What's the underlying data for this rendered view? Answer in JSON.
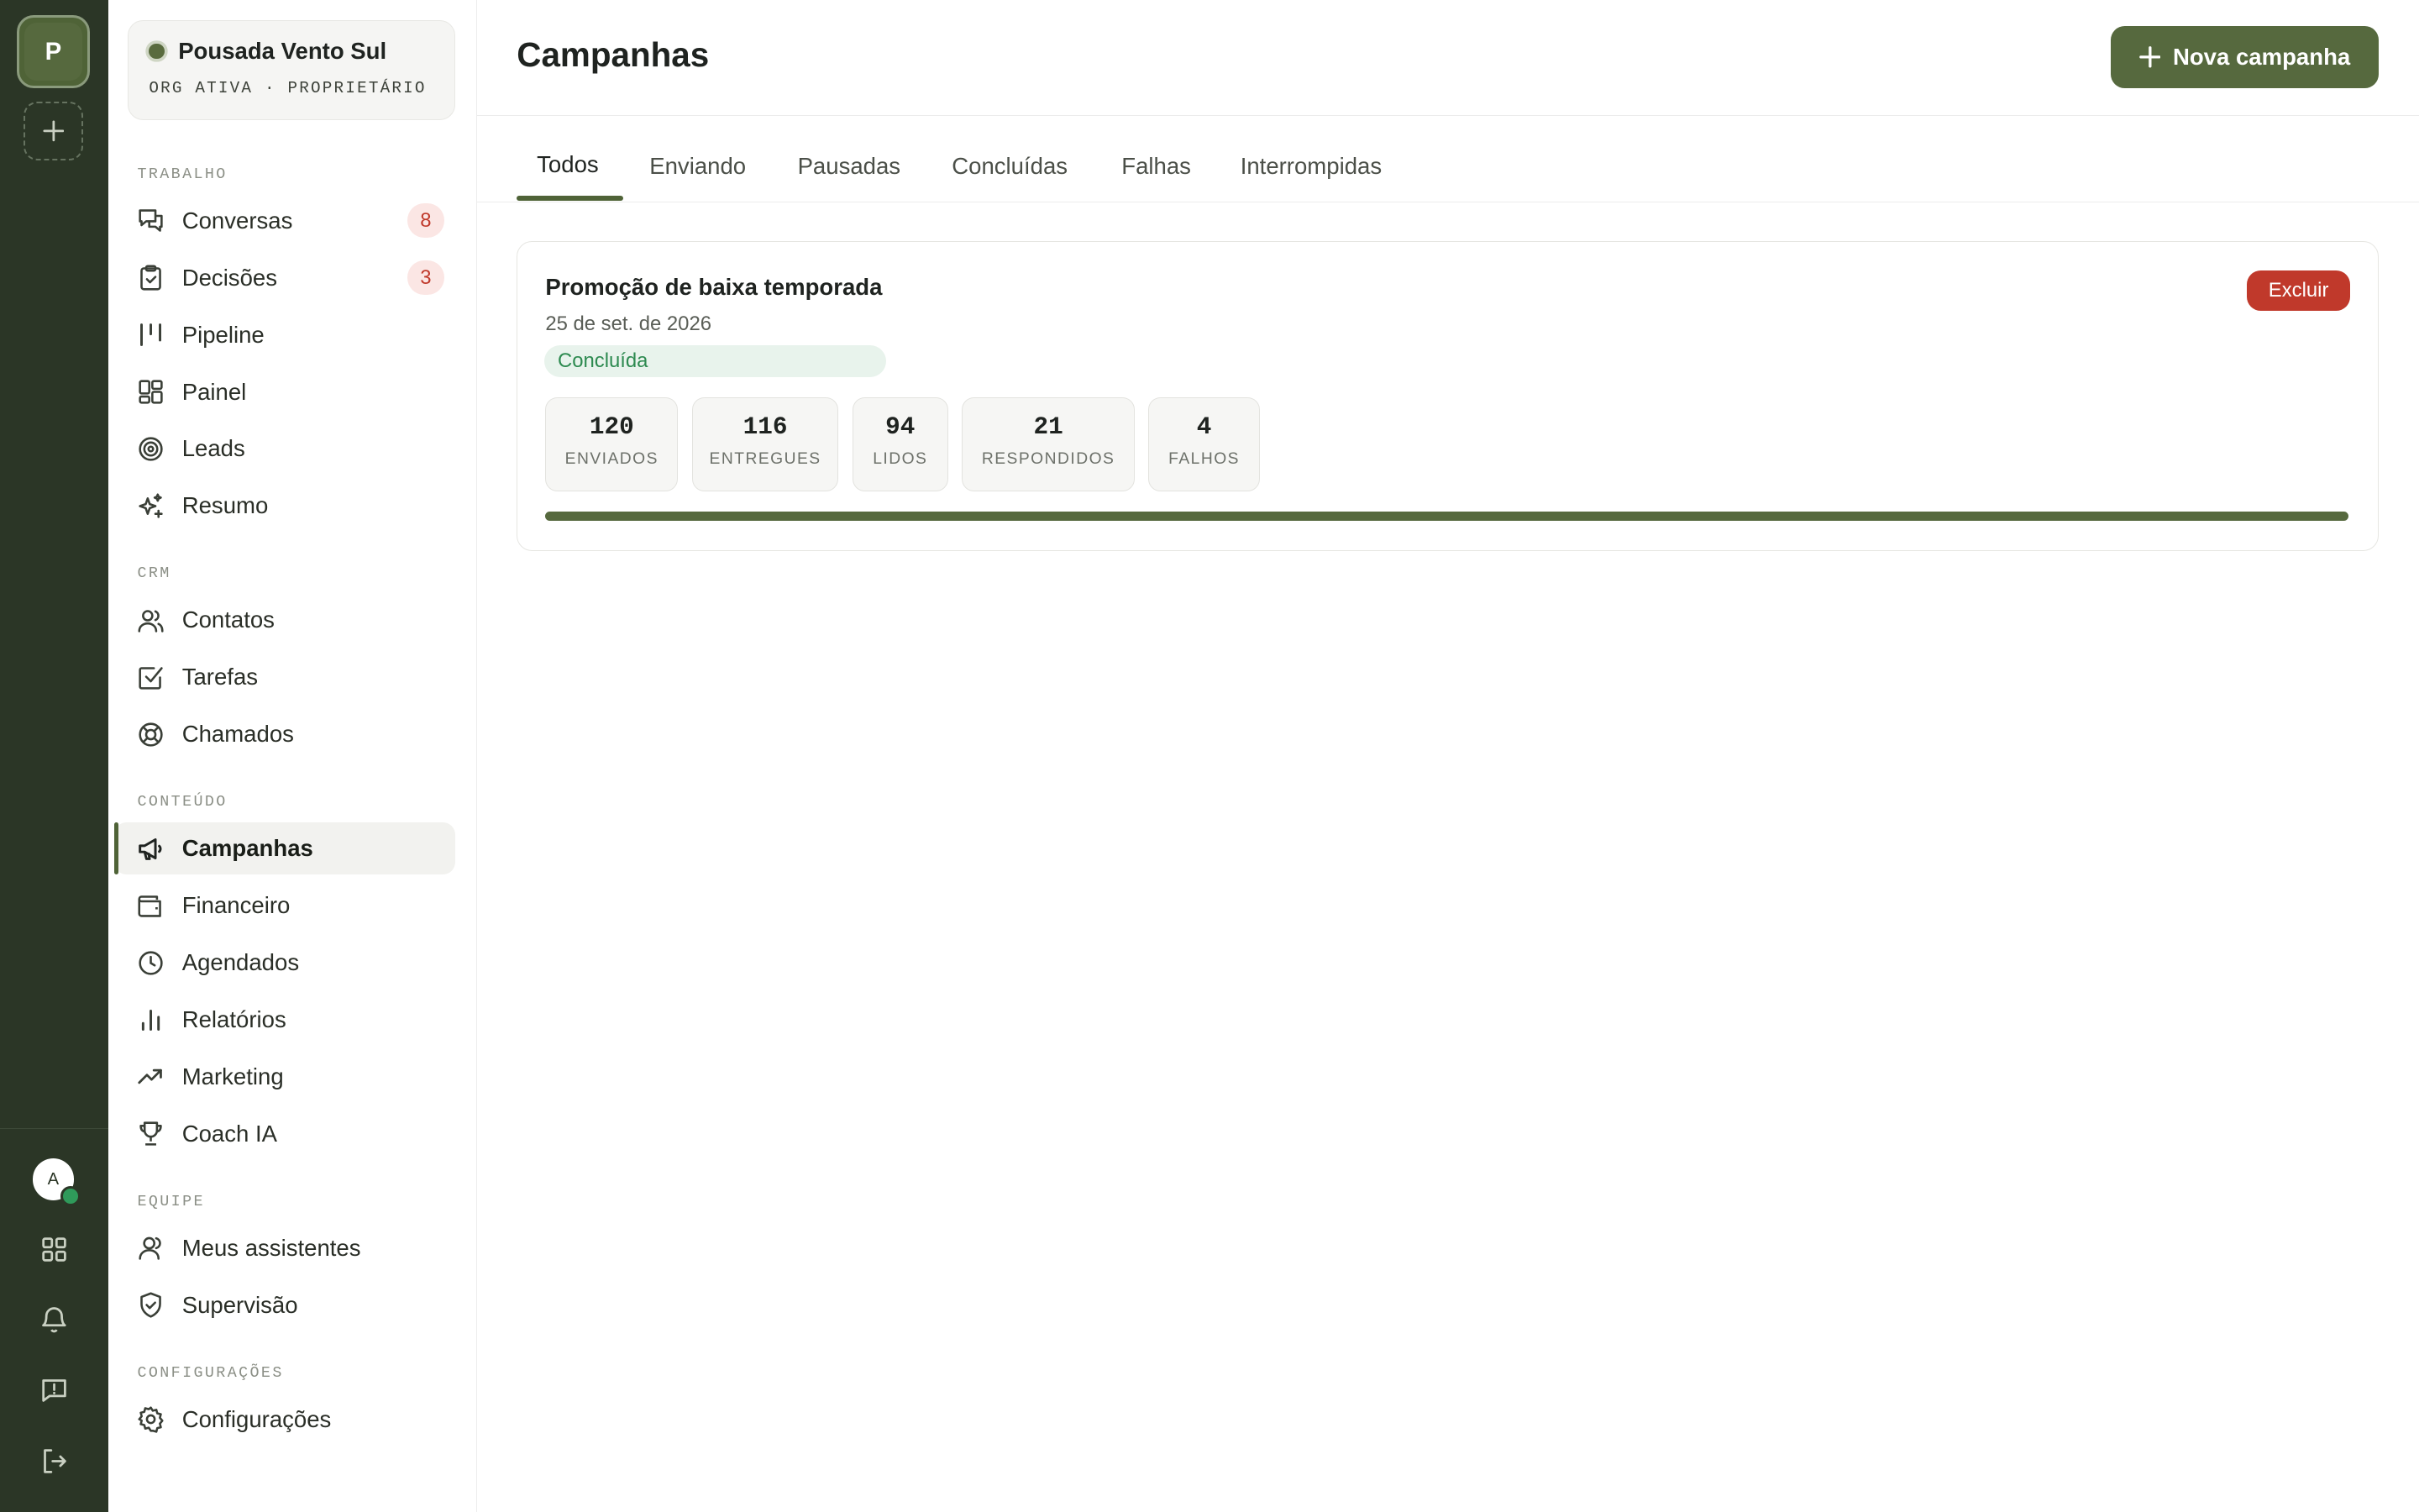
{
  "rail": {
    "org_initial": "P",
    "user_initial": "A",
    "icons": [
      "plus-icon",
      "grid-icon",
      "bell-icon",
      "message-alert-icon",
      "logout-icon"
    ]
  },
  "org": {
    "name": "Pousada Vento Sul",
    "subtitle": "ORG ATIVA · PROPRIETÁRIO"
  },
  "sidebar": {
    "sections": {
      "trabalho": "TRABALHO",
      "crm": "CRM",
      "conteudo": "CONTEÚDO",
      "equipe": "EQUIPE",
      "config": "CONFIGURAÇÕES"
    },
    "items": {
      "conversas": {
        "label": "Conversas",
        "badge": "8",
        "icon": "chat-icon"
      },
      "decisoes": {
        "label": "Decisões",
        "badge": "3",
        "icon": "clipboard-icon"
      },
      "pipeline": {
        "label": "Pipeline",
        "icon": "kanban-icon"
      },
      "painel": {
        "label": "Painel",
        "icon": "dashboard-icon"
      },
      "leads": {
        "label": "Leads",
        "icon": "target-icon"
      },
      "resumo": {
        "label": "Resumo",
        "icon": "sparkles-icon"
      },
      "contatos": {
        "label": "Contatos",
        "icon": "users-icon"
      },
      "tarefas": {
        "label": "Tarefas",
        "icon": "checkbox-icon"
      },
      "chamados": {
        "label": "Chamados",
        "icon": "lifebuoy-icon"
      },
      "campanhas": {
        "label": "Campanhas",
        "icon": "megaphone-icon",
        "active": true
      },
      "financeiro": {
        "label": "Financeiro",
        "icon": "wallet-icon"
      },
      "agendados": {
        "label": "Agendados",
        "icon": "clock-icon"
      },
      "relatorios": {
        "label": "Relatórios",
        "icon": "bar-chart-icon"
      },
      "marketing": {
        "label": "Marketing",
        "icon": "trending-up-icon"
      },
      "coach": {
        "label": "Coach IA",
        "icon": "trophy-icon"
      },
      "assistentes": {
        "label": "Meus assistentes",
        "icon": "user-icon"
      },
      "supervisao": {
        "label": "Supervisão",
        "icon": "shield-check-icon"
      },
      "configuracoes": {
        "label": "Configurações",
        "icon": "gear-icon"
      }
    }
  },
  "header": {
    "title": "Campanhas",
    "new_button": "Nova campanha"
  },
  "tabs": [
    "Todos",
    "Enviando",
    "Pausadas",
    "Concluídas",
    "Falhas",
    "Interrompidas"
  ],
  "campaign": {
    "title": "Promoção de baixa temporada",
    "date": "25 de set. de 2026",
    "status": "Concluída",
    "delete_label": "Excluir",
    "stats": [
      {
        "value": "120",
        "label": "ENVIADOS"
      },
      {
        "value": "116",
        "label": "ENTREGUES"
      },
      {
        "value": "94",
        "label": "LIDOS"
      },
      {
        "value": "21",
        "label": "RESPONDIDOS"
      },
      {
        "value": "4",
        "label": "FALHOS"
      }
    ],
    "progress_percent": 100
  },
  "colors": {
    "rail_bg": "#2b3626",
    "accent": "#56693e",
    "badge_text": "#c0392b",
    "status_green": "#2d8a50",
    "danger": "#c0392b"
  }
}
